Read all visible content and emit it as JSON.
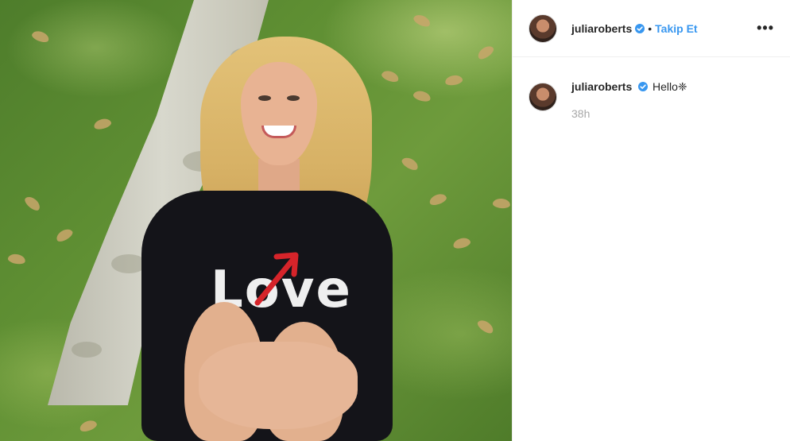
{
  "header": {
    "username": "juliaroberts",
    "separator": "•",
    "follow_label": "Takip Et",
    "more_label": "•••"
  },
  "post": {
    "shirt_text": "Love"
  },
  "caption": {
    "username": "juliaroberts",
    "text": "Hello❈",
    "time": "38h"
  },
  "colors": {
    "link": "#3897f0",
    "verified": "#3897f0",
    "muted": "#a8a8a8",
    "text": "#262626"
  },
  "icons": {
    "verified": "verified-badge-icon",
    "more": "more-options-icon"
  }
}
